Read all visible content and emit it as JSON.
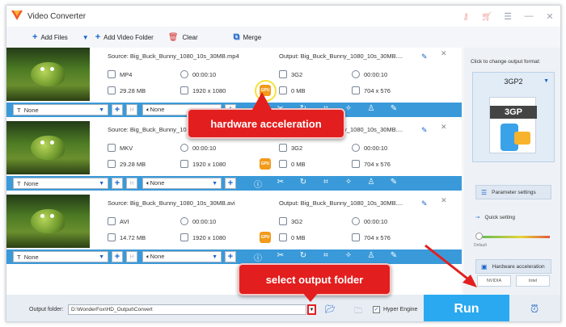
{
  "window": {
    "title": "Video Converter"
  },
  "toolbar": {
    "add_files": "Add Files",
    "add_video_folder": "Add Video Folder",
    "clear": "Clear",
    "merge": "Merge"
  },
  "rows": [
    {
      "source": "Source: Big_Buck_Bunny_1080_10s_30MB.mp4",
      "src_format": "MP4",
      "src_duration": "00:00:10",
      "src_size": "29.28 MB",
      "src_resolution": "1920 x 1080",
      "output": "Output: Big_Buck_Bunny_1080_10s_30MB....",
      "out_format": "3G2",
      "out_duration": "00:00:10",
      "out_size": "0 MB",
      "out_resolution": "704 x 576",
      "gpu": "GPU",
      "subtitle": "None",
      "audio": "None"
    },
    {
      "source": "Source: Big_Buck_Bunny_1080_10s_30MB....",
      "src_format": "MKV",
      "src_duration": "00:00:10",
      "src_size": "29.28 MB",
      "src_resolution": "1920 x 1080",
      "output": "Output: Big_Buck_Bunny_1080_10s_30MB....",
      "out_format": "3G2",
      "out_duration": "00:00:10",
      "out_size": "0 MB",
      "out_resolution": "704 x 576",
      "gpu": "GPU",
      "subtitle": "None",
      "audio": "None"
    },
    {
      "source": "Source: Big_Buck_Bunny_1080_10s_30MB.avi",
      "src_format": "AVI",
      "src_duration": "00:00:10",
      "src_size": "14.72 MB",
      "src_resolution": "1920 x 1080",
      "output": "Output: Big_Buck_Bunny_1080_10s_30MB....",
      "out_format": "3G2",
      "out_duration": "00:00:10",
      "out_size": "0 MB",
      "out_resolution": "704 x 576",
      "gpu": "GPU",
      "subtitle": "None",
      "audio": "None"
    }
  ],
  "side": {
    "click_label": "Click to change output format:",
    "format": "3GP2",
    "file_tag": "3GP",
    "parameter_settings": "Parameter settings",
    "quick_setting": "Quick setting",
    "default": "Default",
    "hardware_acceleration": "Hardware acceleration",
    "nvidia": "NVIDIA",
    "intel": "Intel"
  },
  "bottom": {
    "output_folder_label": "Output folder:",
    "output_folder_value": "D:\\WonderFox\\HD_Output\\Convert",
    "hyper_engine": "Hyper Engine",
    "run": "Run"
  },
  "annotations": {
    "hardware": "hardware acceleration",
    "output_folder": "select output folder"
  },
  "colors": {
    "accent": "#2aa9f0",
    "control_bar": "#3a9ad9",
    "gpu": "#f29a1a",
    "callout": "#e31e1e"
  }
}
